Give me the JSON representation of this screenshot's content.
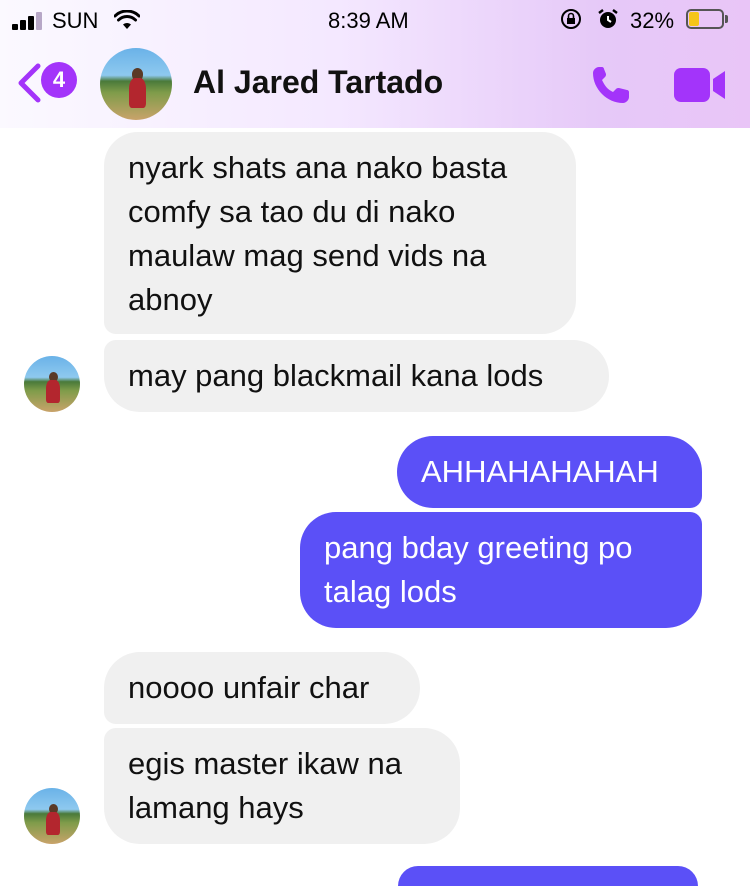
{
  "status_bar": {
    "carrier": "SUN",
    "time": "8:39 AM",
    "battery_percent": "32%",
    "battery_level": 0.32,
    "icons": [
      "signal-icon",
      "wifi-icon",
      "rotation-lock-icon",
      "alarm-icon",
      "battery-icon"
    ]
  },
  "header": {
    "back_badge": "4",
    "contact_name": "Al Jared Tartado",
    "icons": [
      "back-chevron-icon",
      "phone-icon",
      "video-camera-icon"
    ],
    "accent_color": "#a334fa"
  },
  "messages": [
    {
      "sender": "contact",
      "text": "nyark shats ana nako basta\ncomfy sa tao du di nako\nmaulaw mag send vids na\nabnoy"
    },
    {
      "sender": "contact",
      "text": "may pang blackmail kana lods"
    },
    {
      "sender": "me",
      "text": "AHHAHAHAHAH"
    },
    {
      "sender": "me",
      "text": "pang bday greeting po\ntalag lods"
    },
    {
      "sender": "contact",
      "text": "noooo unfair char"
    },
    {
      "sender": "contact",
      "text": "egis master ikaw na\nlamang hays"
    }
  ],
  "colors": {
    "incoming_bubble": "#f0f0f0",
    "outgoing_bubble": "#5b50f7"
  }
}
